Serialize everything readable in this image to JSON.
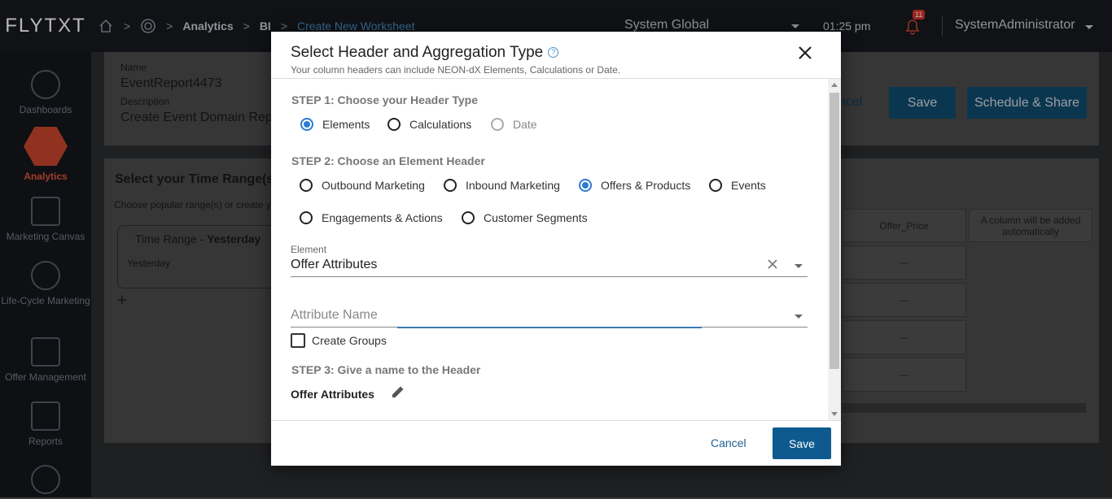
{
  "app": {
    "logo": "FLYTXT",
    "breadcrumbs": [
      "Analytics",
      "BI",
      "Create New Worksheet"
    ],
    "scope": "System Global",
    "time": "01:25 pm",
    "notification_count": "11",
    "user": "SystemAdministrator"
  },
  "sidebar": {
    "items": [
      {
        "label": "Dashboards",
        "icon": "speedometer-icon"
      },
      {
        "label": "Analytics",
        "icon": "line-chart-icon"
      },
      {
        "label": "Marketing Canvas",
        "icon": "canvas-icon"
      },
      {
        "label": "Life-Cycle Marketing",
        "icon": "megaphone-icon"
      },
      {
        "label": "Offer Management",
        "icon": "gift-icon"
      },
      {
        "label": "Reports",
        "icon": "report-icon"
      },
      {
        "label": "",
        "icon": "gear-icon"
      }
    ]
  },
  "worksheet": {
    "name_label": "Name",
    "name_value": "EventReport4473",
    "description_label": "Description",
    "description_value": "Create Event Domain Rep",
    "cancel_label": "ncel",
    "save_label": "Save",
    "schedule_label": "Schedule & Share",
    "time_range_title": "Select your Time Range(s",
    "time_range_sub": "Choose popular range(s) or create y",
    "time_range_card_title": "Time Range - ",
    "time_range_card_bold": "Yesterday",
    "time_range_card_value": "Yesterday",
    "add_label": "+",
    "col_header": "Offer_Price",
    "auto_col": "A column will be added automatically",
    "cell_value": "---"
  },
  "modal": {
    "title": "Select Header and Aggregation Type",
    "subtitle": "Your column headers can include NEON-dX Elements, Calculations or Date.",
    "step1": "STEP 1: Choose your Header Type",
    "header_types": [
      {
        "label": "Elements",
        "checked": true
      },
      {
        "label": "Calculations",
        "checked": false
      },
      {
        "label": "Date",
        "checked": false,
        "disabled": true
      }
    ],
    "step2": "STEP 2: Choose an Element Header",
    "element_headers": [
      {
        "label": "Outbound Marketing",
        "checked": false
      },
      {
        "label": "Inbound Marketing",
        "checked": false
      },
      {
        "label": "Offers & Products",
        "checked": true
      },
      {
        "label": "Events",
        "checked": false
      },
      {
        "label": "Engagements & Actions",
        "checked": false
      },
      {
        "label": "Customer Segments",
        "checked": false
      }
    ],
    "element_label": "Element",
    "element_value": "Offer Attributes",
    "attribute_placeholder": "Attribute Name",
    "create_groups_label": "Create Groups",
    "step3": "STEP 3: Give a name to the Header",
    "header_name": "Offer Attributes",
    "cancel_label": "Cancel",
    "save_label": "Save"
  },
  "colors": {
    "primary": "#0e5a8e",
    "radio_checked": "#2d7bd3",
    "analytics_accent": "#c8462c"
  }
}
